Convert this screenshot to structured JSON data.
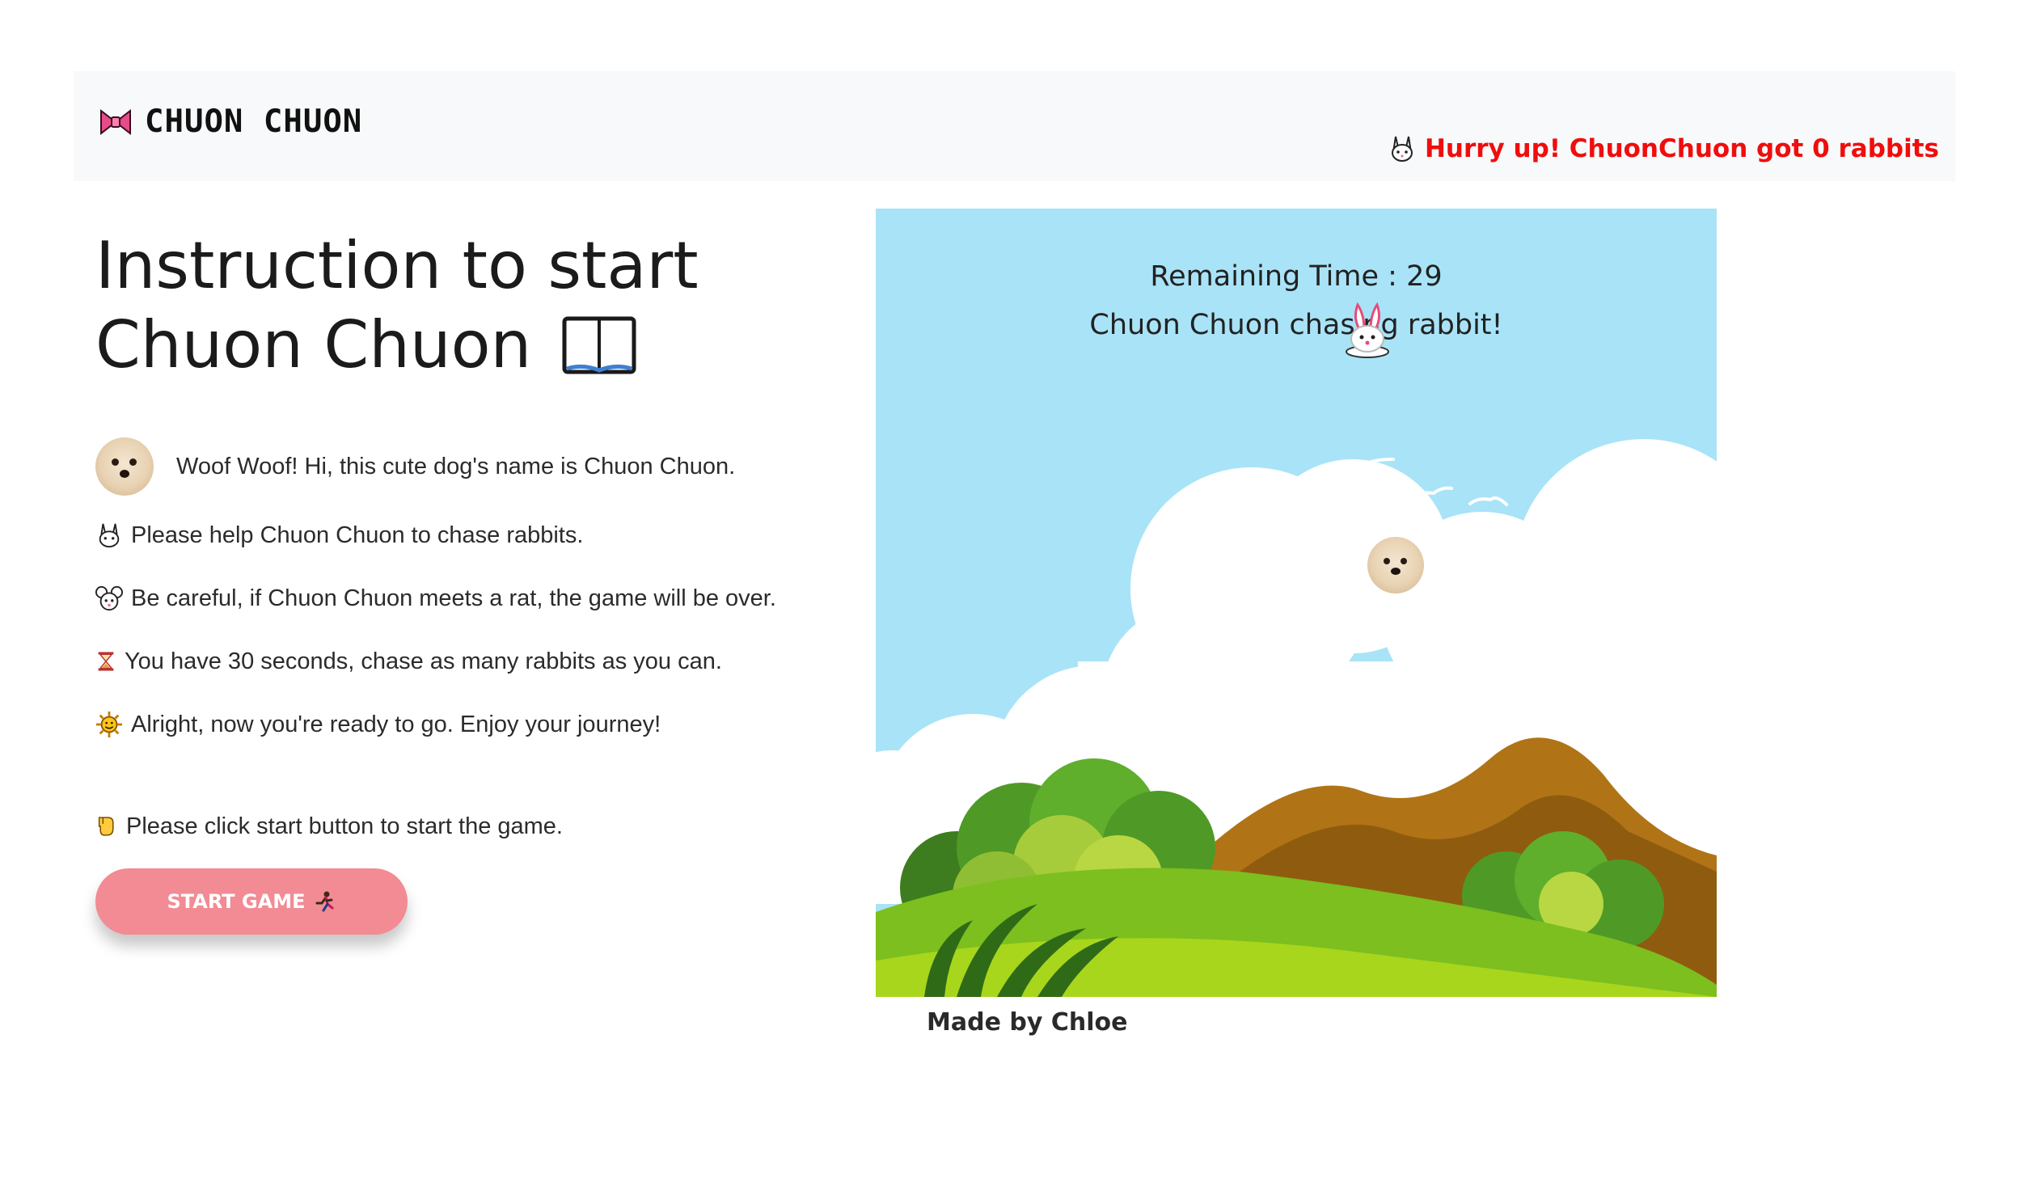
{
  "header": {
    "brand_title": "CHUON CHUON",
    "brand_icon": "bow-icon",
    "status_text": "Hurry up! ChuonChuon got 0 rabbits",
    "status_icon": "rabbit-face-icon",
    "status_color": "#f00d0d",
    "background": "#f8f9fa"
  },
  "instructions": {
    "heading_line1": "Instruction to start",
    "heading_line2": "Chuon Chuon",
    "heading_icon": "open-book-icon",
    "items": [
      {
        "icon": "dog-avatar",
        "text": "Woof Woof! Hi, this cute dog's name is Chuon Chuon."
      },
      {
        "icon": "rabbit-face-icon",
        "text": "Please help Chuon Chuon to chase rabbits."
      },
      {
        "icon": "mouse-face-icon",
        "text": "Be careful, if Chuon Chuon meets a rat, the game will be over."
      },
      {
        "icon": "hourglass-icon",
        "text": "You have 30 seconds, chase as many rabbits as you can."
      },
      {
        "icon": "sun-icon",
        "text": "Alright, now you're ready to go. Enjoy your journey!"
      }
    ],
    "click_hint": "Please click start button to start the game.",
    "click_hint_icon": "pointing-down-icon",
    "start_button_label": "START GAME",
    "start_button_icon": "running-icon",
    "start_button_color": "#f28b94"
  },
  "game": {
    "timer_text": "Remaining Time : 29",
    "subtitle": "Chuon Chuon chasing rabbit!",
    "sky_color": "#a9e3f7",
    "characters": [
      "dog-player",
      "rabbit-target"
    ]
  },
  "footer": {
    "credit": "Made by Chloe"
  }
}
